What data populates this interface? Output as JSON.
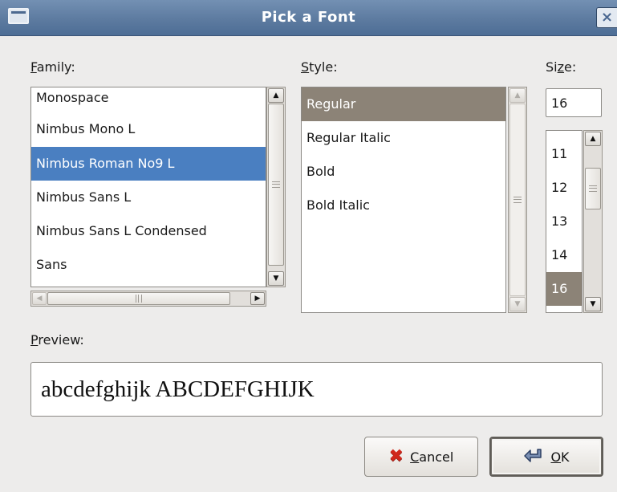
{
  "window": {
    "title": "Pick a Font",
    "close_glyph": "×"
  },
  "family": {
    "label_accel": "F",
    "label_rest": "amily:",
    "items": [
      "Monospace",
      "Nimbus Mono L",
      "Nimbus Roman No9 L",
      "Nimbus Sans L",
      "Nimbus Sans L Condensed",
      "Sans"
    ],
    "selected": "Nimbus Roman No9 L"
  },
  "style": {
    "label_accel": "S",
    "label_rest": "tyle:",
    "items": [
      "Regular",
      "Regular Italic",
      "Bold",
      "Bold Italic"
    ],
    "selected": "Regular"
  },
  "size": {
    "label_pre": "Si",
    "label_accel": "z",
    "label_rest": "e:",
    "value": "16",
    "items": [
      "11",
      "12",
      "13",
      "14",
      "16"
    ],
    "selected": "16"
  },
  "preview": {
    "label_accel": "P",
    "label_rest": "review:",
    "text": "abcdefghijk ABCDEFGHIJK"
  },
  "buttons": {
    "cancel_accel": "C",
    "cancel_rest": "ancel",
    "ok_accel": "O",
    "ok_rest": "K"
  },
  "icons": {
    "scroll_up": "▲",
    "scroll_down": "▼",
    "scroll_left": "◀",
    "scroll_right": "▶",
    "cancel": "✖"
  }
}
